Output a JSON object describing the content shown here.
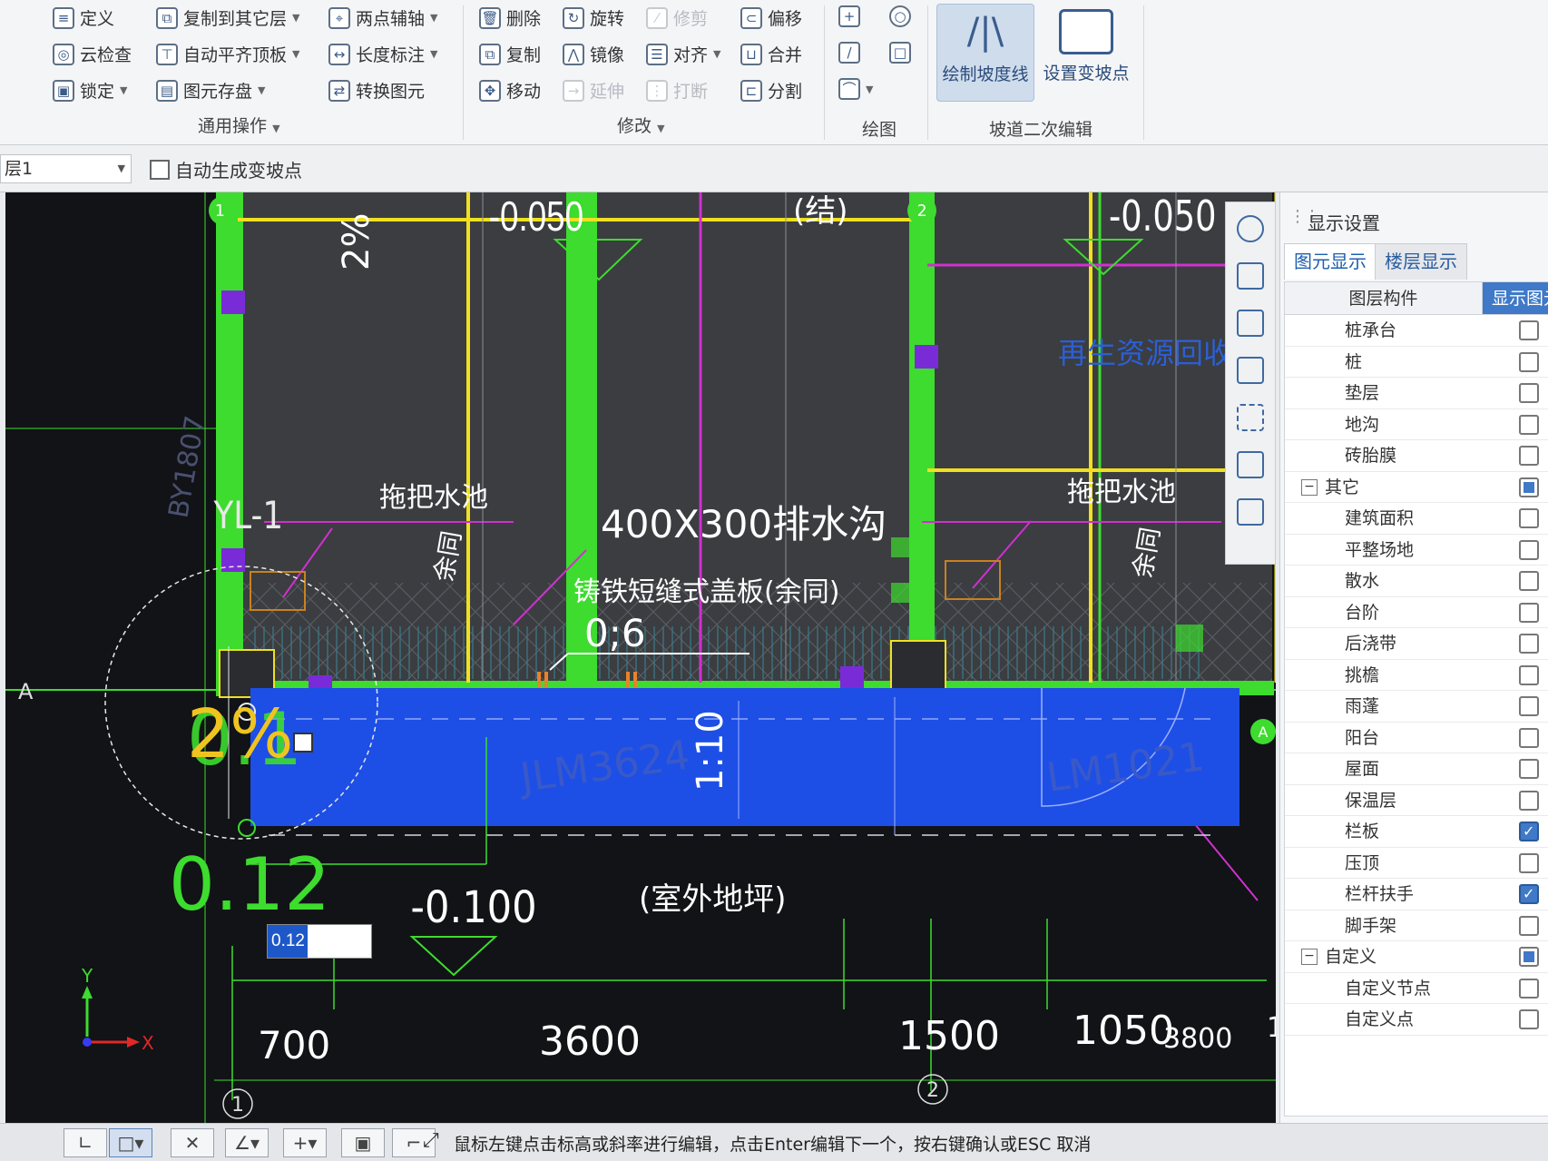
{
  "ribbon": {
    "general": {
      "define": "定义",
      "copy_to_other_floor": "复制到其它层",
      "two_point_axis": "两点辅轴",
      "cloud_check": "云检查",
      "auto_align_top": "自动平齐顶板",
      "length_dim": "长度标注",
      "lock": "锁定",
      "element_save": "图元存盘",
      "convert_element": "转换图元",
      "group_label": "通用操作"
    },
    "modify": {
      "delete": "删除",
      "rotate": "旋转",
      "trim": "修剪",
      "offset": "偏移",
      "copy": "复制",
      "mirror": "镜像",
      "align": "对齐",
      "merge": "合并",
      "move": "移动",
      "extend": "延伸",
      "break": "打断",
      "split": "分割",
      "group_label": "修改"
    },
    "draw": {
      "group_label": "绘图"
    },
    "ramp": {
      "draw_slope_line": "绘制坡度线",
      "set_change_point": "设置变坡点",
      "group_label": "坡道二次编辑"
    }
  },
  "options": {
    "floor": "层1",
    "auto_generate_label": "自动生成变坡点"
  },
  "cad": {
    "axis_1": "1",
    "axis_2": "2",
    "axis_a": "A",
    "elev_1": "-0.050",
    "elev_note": "(结)",
    "elev_2": "-0.050",
    "slope_2pct": "2%",
    "yl1": "YL-1",
    "mop_pool_1": "拖把水池",
    "mop_pool_2": "拖把水池",
    "same_1": "余同",
    "same_2": "余同",
    "drain": "400X300排水沟",
    "cover": "铸铁短缝式盖板(余同)",
    "recycle": "再生资源回收站",
    "ratio": "0;6",
    "door_1": "JLM3624",
    "door_2": "LM1021",
    "slope_110": "1:10",
    "by": "BY1807",
    "edit_slope": "2%",
    "edit_value_bg": "0.1",
    "edit_elev": "0.12",
    "input_value": "0.12",
    "outdoor_elev": "-0.100",
    "outdoor_note": "(室外地坪)",
    "dim_700": "700",
    "dim_3600": "3600",
    "dim_1500": "1500",
    "dim_1050": "1050",
    "dim_3800": "3800",
    "dim_1": "1",
    "x_label": "X",
    "y_label": "Y"
  },
  "panel": {
    "title": "显示设置",
    "tab_elements": "图元显示",
    "tab_floors": "楼层显示",
    "col_component": "图层构件",
    "col_show": "显示图元",
    "rows": [
      {
        "label": "桩承台",
        "checked": false,
        "level": 1
      },
      {
        "label": "桩",
        "checked": false,
        "level": 1
      },
      {
        "label": "垫层",
        "checked": false,
        "level": 1
      },
      {
        "label": "地沟",
        "checked": false,
        "level": 1
      },
      {
        "label": "砖胎膜",
        "checked": false,
        "level": 1
      },
      {
        "label": "其它",
        "checked": "partial",
        "level": 0,
        "expand": "−"
      },
      {
        "label": "建筑面积",
        "checked": false,
        "level": 1
      },
      {
        "label": "平整场地",
        "checked": false,
        "level": 1
      },
      {
        "label": "散水",
        "checked": false,
        "level": 1
      },
      {
        "label": "台阶",
        "checked": false,
        "level": 1
      },
      {
        "label": "后浇带",
        "checked": false,
        "level": 1
      },
      {
        "label": "挑檐",
        "checked": false,
        "level": 1
      },
      {
        "label": "雨蓬",
        "checked": false,
        "level": 1
      },
      {
        "label": "阳台",
        "checked": false,
        "level": 1
      },
      {
        "label": "屋面",
        "checked": false,
        "level": 1
      },
      {
        "label": "保温层",
        "checked": false,
        "level": 1
      },
      {
        "label": "栏板",
        "checked": true,
        "level": 1
      },
      {
        "label": "压顶",
        "checked": false,
        "level": 1
      },
      {
        "label": "栏杆扶手",
        "checked": true,
        "level": 1
      },
      {
        "label": "脚手架",
        "checked": false,
        "level": 1
      },
      {
        "label": "自定义",
        "checked": "partial",
        "level": 0,
        "expand": "−"
      },
      {
        "label": "自定义节点",
        "checked": false,
        "level": 1
      },
      {
        "label": "自定义点",
        "checked": false,
        "level": 1
      }
    ]
  },
  "status": {
    "hint": "鼠标左键点击标高或斜率进行编辑，点击Enter编辑下一个，按右键确认或ESC 取消"
  },
  "colors": {
    "green": "#3ddc2e",
    "yellow": "#f0e020",
    "magenta": "#d030d0",
    "blue_fill": "#1d4fe6",
    "purple": "#7a2bd8"
  }
}
